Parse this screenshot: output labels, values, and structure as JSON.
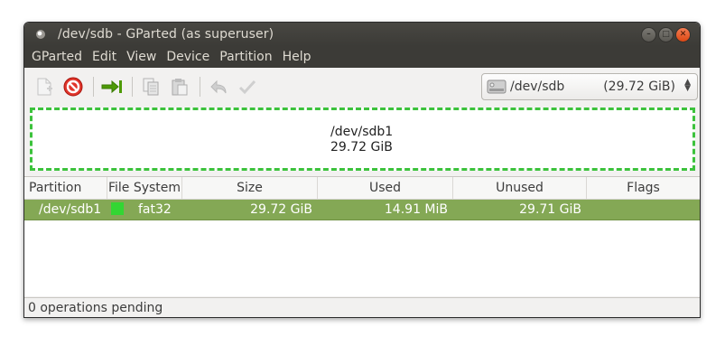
{
  "window": {
    "title": "/dev/sdb - GParted (as superuser)"
  },
  "menu": [
    "GParted",
    "Edit",
    "View",
    "Device",
    "Partition",
    "Help"
  ],
  "toolbar": {
    "icons": [
      "new-partition-icon",
      "delete-icon",
      "resize-move-icon",
      "copy-icon",
      "paste-icon",
      "undo-icon",
      "apply-icon"
    ]
  },
  "device": {
    "name": "/dev/sdb",
    "size": "(29.72 GiB)"
  },
  "graph": {
    "partition_name": "/dev/sdb1",
    "partition_size": "29.72 GiB"
  },
  "table": {
    "headers": [
      "Partition",
      "File System",
      "Size",
      "Used",
      "Unused",
      "Flags"
    ],
    "rows": [
      {
        "partition": "/dev/sdb1",
        "filesystem": "fat32",
        "fs_color": "#33d633",
        "size": "29.72 GiB",
        "used": "14.91 MiB",
        "unused": "29.71 GiB",
        "flags": ""
      }
    ]
  },
  "status": {
    "text": "0 operations pending"
  },
  "colors": {
    "selected_row": "#84a855",
    "partition_border": "#3cc23c",
    "titlebar": "#3c3b37",
    "close_button": "#dd4814"
  }
}
